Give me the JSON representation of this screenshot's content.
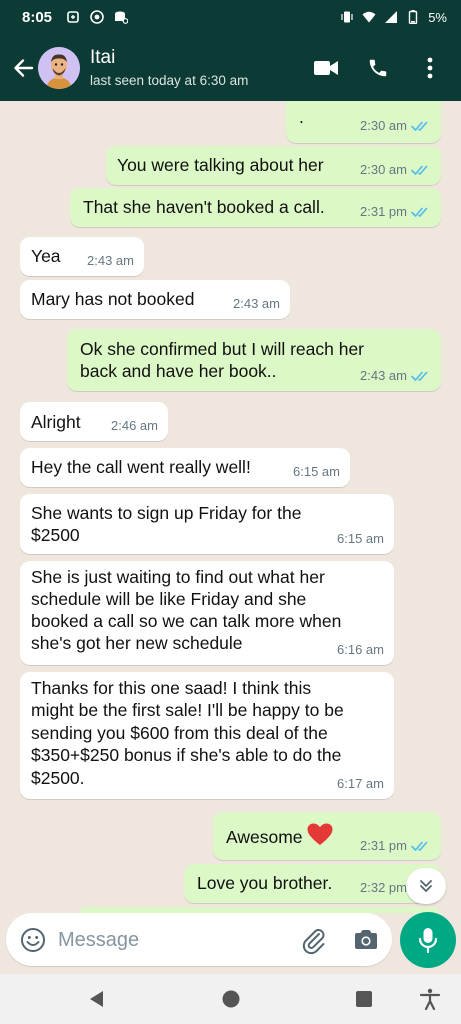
{
  "status_bar": {
    "time": "8:05",
    "battery": "5%"
  },
  "header": {
    "contact_name": "Itai",
    "contact_status": "last seen today at 6:30 am"
  },
  "messages": [
    {
      "direction": "out",
      "text": ".",
      "time": "2:30 am",
      "read": true
    },
    {
      "direction": "out",
      "text": "You were talking about her",
      "time": "2:30 am",
      "read": true
    },
    {
      "direction": "out",
      "text": "That she haven't booked a call.",
      "time": "2:31 pm",
      "read": true
    },
    {
      "direction": "in",
      "text": "Yea",
      "time": "2:43 am"
    },
    {
      "direction": "in",
      "text": "Mary has not booked",
      "time": "2:43 am"
    },
    {
      "direction": "out",
      "lines": [
        "Ok she confirmed but I will reach her",
        "back and have her book.."
      ],
      "time": "2:43 am",
      "read": true
    },
    {
      "direction": "in",
      "text": "Alright",
      "time": "2:46 am"
    },
    {
      "direction": "in",
      "text": "Hey the call went really well!",
      "time": "6:15 am"
    },
    {
      "direction": "in",
      "lines": [
        "She wants to sign up Friday for the",
        "$2500"
      ],
      "time": "6:15 am"
    },
    {
      "direction": "in",
      "lines": [
        "She is just waiting to find out what her",
        "schedule will be like Friday and she",
        "booked a call so we can talk more when",
        "she's got her new schedule"
      ],
      "time": "6:16 am"
    },
    {
      "direction": "in",
      "lines": [
        "Thanks for this one saad! I think this",
        "might be the first sale! I'll be happy to be",
        "sending you $600 from this deal of the",
        "$350+$250 bonus if she's able to do the",
        "$2500."
      ],
      "time": "6:17 am"
    },
    {
      "direction": "out",
      "text": "Awesome",
      "emoji": "red-heart",
      "time": "2:31 pm",
      "read": true
    },
    {
      "direction": "out",
      "text": "Love you brother.",
      "time": "2:32 pm",
      "read": true
    }
  ],
  "composer": {
    "placeholder": "Message"
  },
  "colors": {
    "header": "#0c3a34",
    "incoming_bubble": "#ffffff",
    "outgoing_bubble": "#dcf8c6",
    "read_ticks": "#53bdeb",
    "mic_button": "#00a884",
    "chat_background": "#efe7dd"
  }
}
